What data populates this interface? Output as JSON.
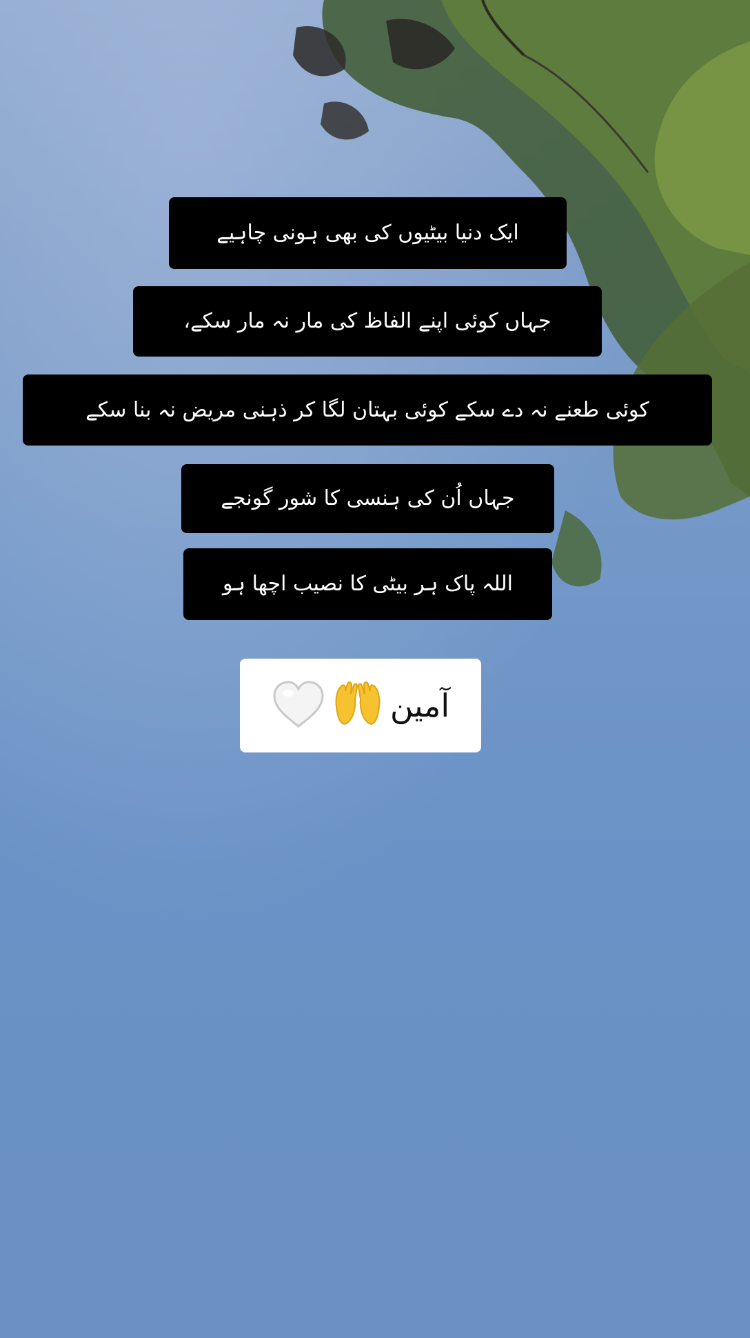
{
  "captions": [
    "ایک دنیا بیٹیوں کی بھی ہونی چاہیے",
    "جہاں کوئی اپنے الفاظ کی   مار نہ مار سکے،",
    "کوئی طعنے نہ دے سکے کوئی بہتان لگا کر ذہنی مریض نہ بنا سکے",
    "جہاں اُن کی ہنسی کا شور گونجے",
    "اللہ پاک ہر بیٹی کا نصیب اچھا ہو"
  ],
  "amen": {
    "text": "آمین",
    "icons": [
      "raised-hands-icon",
      "white-heart-icon"
    ]
  },
  "colors": {
    "sky_top": "#8fa9cf",
    "sky_bottom": "#6b90c2",
    "caption_bg": "#000000",
    "caption_text": "#ffffff",
    "amen_bg": "#ffffff"
  }
}
